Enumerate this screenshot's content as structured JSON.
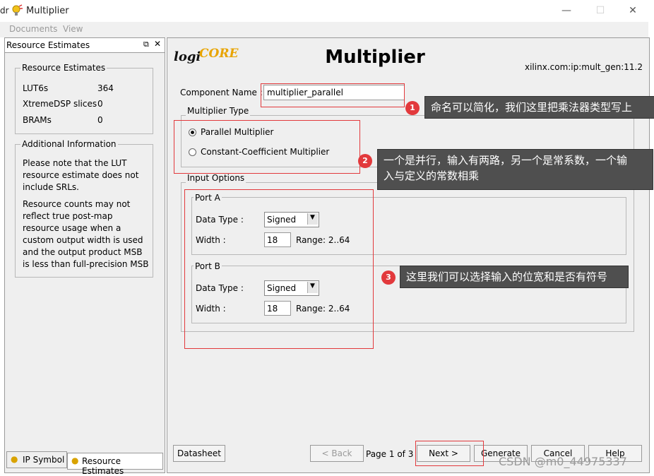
{
  "window": {
    "edge_chars": "dr",
    "title": "Multiplier"
  },
  "menu": {
    "items": [
      "Documents",
      "View"
    ]
  },
  "left_panel": {
    "header": "Resource Estimates",
    "resource_group": {
      "label": "Resource Estimates",
      "rows": [
        {
          "name": "LUT6s",
          "value": "364"
        },
        {
          "name": "XtremeDSP slices",
          "value": "0"
        },
        {
          "name": "BRAMs",
          "value": "0"
        }
      ]
    },
    "info_group": {
      "label": "Additional Information",
      "para1": "Please note that the LUT resource estimate does not include SRLs.",
      "para2": "Resource counts may not reflect true post-map resource usage when a custom output width is used and the output product MSB is less than full-precision MSB"
    },
    "tabs": [
      "IP Symbol",
      "Resource Estimates"
    ]
  },
  "main": {
    "logo_text_left": "logi",
    "logo_text_right": "CORE",
    "title": "Multiplier",
    "version": "xilinx.com:ip:mult_gen:11.2",
    "component_name_label": "Component Name :",
    "component_name_value": "multiplier_parallel",
    "multiplier_type": {
      "label": "Multiplier Type",
      "options": [
        "Parallel Multiplier",
        "Constant-Coefficient Multiplier"
      ],
      "selected": "Parallel Multiplier"
    },
    "input_options": {
      "label": "Input Options",
      "port_a": {
        "label": "Port A",
        "data_type_label": "Data Type :",
        "data_type_value": "Signed",
        "width_label": "Width :",
        "width_value": "18",
        "range": "Range: 2..64"
      },
      "port_b": {
        "label": "Port B",
        "data_type_label": "Data Type :",
        "data_type_value": "Signed",
        "width_label": "Width :",
        "width_value": "18",
        "range": "Range: 2..64"
      }
    },
    "buttons": {
      "datasheet": "Datasheet",
      "back": "< Back",
      "page": "Page 1 of 3",
      "next": "Next >",
      "generate": "Generate",
      "cancel": "Cancel",
      "help": "Help"
    }
  },
  "annotations": [
    {
      "num": "1",
      "text": "命名可以简化，我们这里把乘法器类型写上"
    },
    {
      "num": "2",
      "line1": "一个是并行，输入有两路，另一个是常系数，一个输",
      "line2": "入与定义的常数相乘"
    },
    {
      "num": "3",
      "text": "这里我们可以选择输入的位宽和是否有符号"
    }
  ],
  "watermark": "CSDN @m0_44975337",
  "colors": {
    "annotation_red": "#e2393c",
    "callout_bg": "#4f4f4f",
    "panel_bg": "#efefef"
  }
}
